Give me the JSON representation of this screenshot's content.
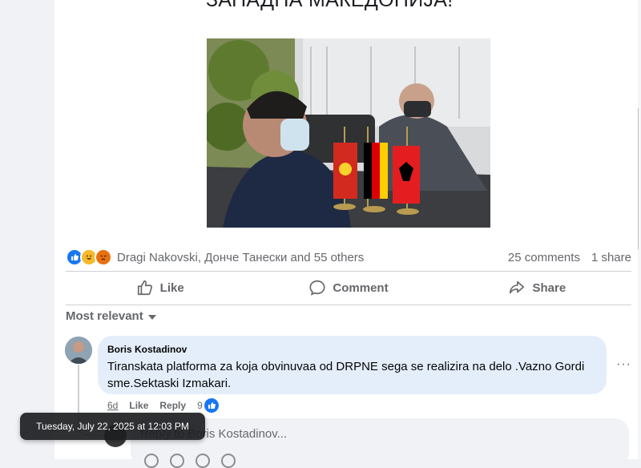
{
  "post": {
    "headline": "ЗАПАДНА МАКЕДОНИЈА!"
  },
  "reactions": {
    "summary": "Dragi Nakovski, Донче Танески and 55 others",
    "comments_count": "25 comments",
    "shares_count": "1 share",
    "icons": [
      "like-icon",
      "haha-icon",
      "angry-icon"
    ]
  },
  "actions": {
    "like": "Like",
    "comment": "Comment",
    "share": "Share"
  },
  "sort": {
    "label": "Most relevant"
  },
  "comment": {
    "author": "Boris Kostadinov",
    "text": "Tiranskata platforma za koja obvinuvaa od DRPNE sega se realizira na delo .Vazno Gordi sme.Sektaski Izmakari.",
    "time": "6d",
    "like_label": "Like",
    "reply_label": "Reply",
    "like_count": "9",
    "more": "···"
  },
  "reply": {
    "placeholder": "Reply to Boris Kostadinov..."
  },
  "tooltip": {
    "text": "Tuesday, July 22, 2025 at 12:03 PM"
  },
  "colors": {
    "accent": "#1877f2",
    "bubble": "#e4eefb",
    "muted": "#65676b"
  }
}
